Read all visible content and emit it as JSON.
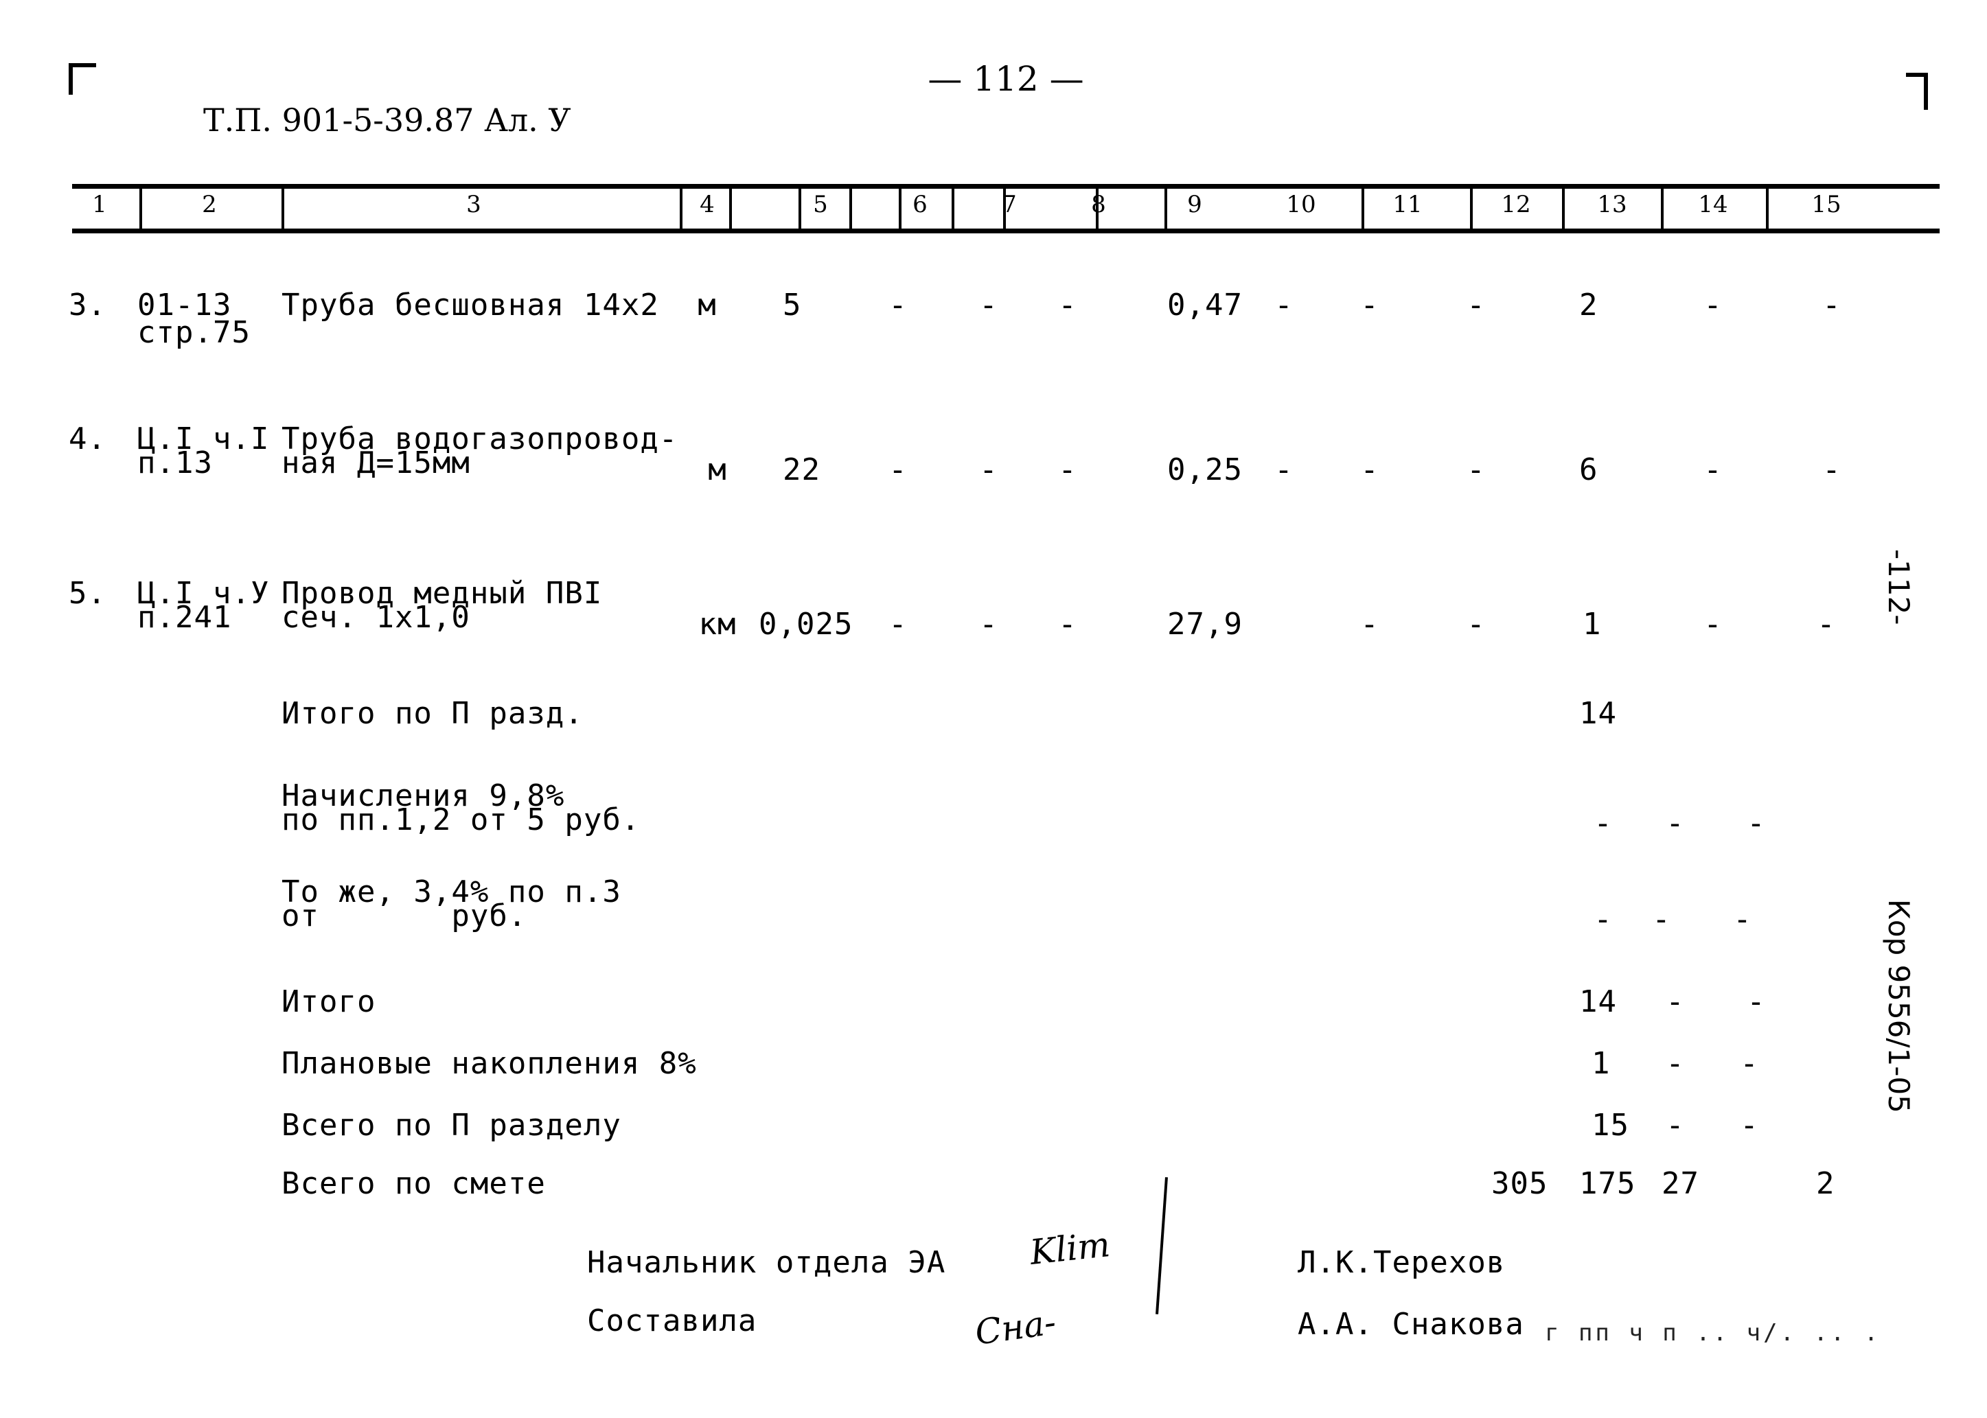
{
  "header": {
    "doc_code": "Т.П. 901-5-39.87 Ал. У",
    "page_number": "— 112 —"
  },
  "table": {
    "column_numbers": [
      "1",
      "2",
      "3",
      "4",
      "5",
      "6",
      "7",
      "8",
      "9",
      "10",
      "11",
      "12",
      "13",
      "14",
      "15"
    ],
    "rows": [
      {
        "num": "3.",
        "ref_line1": "01-13",
        "ref_line2": "стр.75",
        "name_line1": "Труба бесшовная 14х2",
        "name_line2": "",
        "unit": "м",
        "qty": "5",
        "c6": "-",
        "c7": "-",
        "c8": "-",
        "c9": "0,47",
        "c10": "-",
        "c11": "-",
        "c12": "-",
        "c13": "2",
        "c14": "-",
        "c15": "-"
      },
      {
        "num": "4.",
        "ref_line1": "Ц.I ч.I",
        "ref_line2": "п.13",
        "name_line1": "Труба водогазопровод-",
        "name_line2": "ная Д=15мм",
        "unit": "м",
        "qty": "22",
        "c6": "-",
        "c7": "-",
        "c8": "-",
        "c9": "0,25",
        "c10": "-",
        "c11": "-",
        "c12": "-",
        "c13": "6",
        "c14": "-",
        "c15": "-"
      },
      {
        "num": "5.",
        "ref_line1": "Ц.I ч.У",
        "ref_line2": "п.241",
        "name_line1": "Провод медный ПВI",
        "name_line2": "сеч. 1х1,0",
        "unit": "км",
        "qty": "0,025",
        "c6": "-",
        "c7": "-",
        "c8": "-",
        "c9": "27,9",
        "c10": "",
        "c11": "-",
        "c12": "-",
        "c13": "1",
        "c14": "-",
        "c15": "-"
      }
    ],
    "summary": [
      {
        "label_line1": "Итого по П разд.",
        "label_line2": "",
        "c12": "",
        "c13": "14",
        "c14": "",
        "c15": ""
      },
      {
        "label_line1": "Начисления 9,8%",
        "label_line2": "по пп.1,2 от 5 руб.",
        "c12": "",
        "c13": "-",
        "c14": "-",
        "c15": "-"
      },
      {
        "label_line1": "То же, 3,4% по п.3",
        "label_line2": "от       руб.",
        "c12": "",
        "c13": "-",
        "c14": "-",
        "c15": "-"
      },
      {
        "label_line1": "Итого",
        "label_line2": "",
        "c12": "",
        "c13": "14",
        "c14": "-",
        "c15": "-"
      },
      {
        "label_line1": "Плановые накопления 8%",
        "label_line2": "",
        "c12": "",
        "c13": "1",
        "c14": "-",
        "c15": "-"
      },
      {
        "label_line1": "Всего по П разделу",
        "label_line2": "",
        "c12": "",
        "c13": "15",
        "c14": "-",
        "c15": "-"
      },
      {
        "label_line1": "Всего по смете",
        "label_line2": "",
        "c12": "305",
        "c13": "175",
        "c14": "27",
        "c15": "2"
      }
    ]
  },
  "signatures": {
    "head_label": "Начальник отдела ЭА",
    "head_name": "Л.К.Терехов",
    "head_signature": "Klim",
    "compiler_label": "Составила",
    "compiler_name": "А.А. Снакова",
    "compiler_signature": "Сна-",
    "faded_trailing_text": "г пп ч п .. ч/. .. ."
  },
  "margin_notes": {
    "page_marker": "-112-",
    "archive_code": "Кор 9556/1-05"
  }
}
